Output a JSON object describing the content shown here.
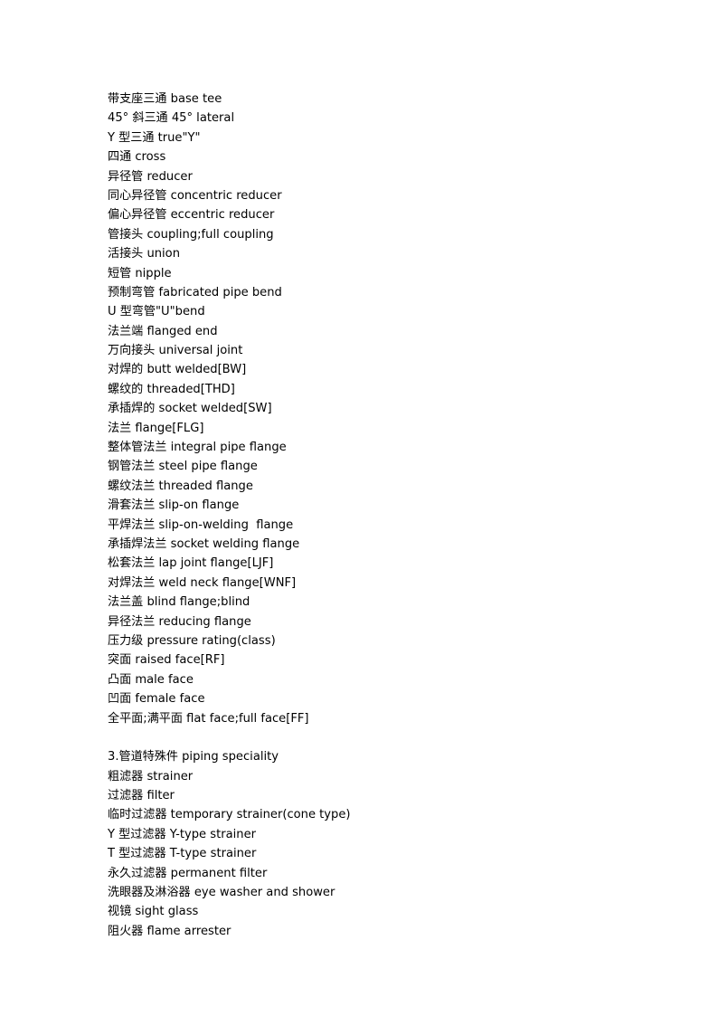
{
  "document": {
    "page_background": "#ffffff",
    "text_color": "#000000",
    "entries": [
      {
        "text": "带支座三通 base tee",
        "kind": "entry"
      },
      {
        "text": "45° 斜三通 45° lateral",
        "kind": "entry"
      },
      {
        "text": "Y 型三通 true\"Y\"",
        "kind": "entry"
      },
      {
        "text": "四通 cross",
        "kind": "entry"
      },
      {
        "text": "异径管 reducer",
        "kind": "entry"
      },
      {
        "text": "同心异径管 concentric reducer",
        "kind": "entry"
      },
      {
        "text": "偏心异径管 eccentric reducer",
        "kind": "entry"
      },
      {
        "text": "管接头 coupling;full coupling",
        "kind": "entry"
      },
      {
        "text": "活接头 union",
        "kind": "entry"
      },
      {
        "text": "短管 nipple",
        "kind": "entry"
      },
      {
        "text": "预制弯管 fabricated pipe bend",
        "kind": "entry"
      },
      {
        "text": "U 型弯管\"U\"bend",
        "kind": "entry"
      },
      {
        "text": "法兰端 flanged end",
        "kind": "entry"
      },
      {
        "text": "万向接头 universal joint",
        "kind": "entry"
      },
      {
        "text": "对焊的 butt welded[BW]",
        "kind": "entry"
      },
      {
        "text": "螺纹的 threaded[THD]",
        "kind": "entry"
      },
      {
        "text": "承插焊的 socket welded[SW]",
        "kind": "entry"
      },
      {
        "text": "法兰 flange[FLG]",
        "kind": "entry"
      },
      {
        "text": "整体管法兰 integral pipe flange",
        "kind": "entry"
      },
      {
        "text": "钢管法兰 steel pipe flange",
        "kind": "entry"
      },
      {
        "text": "螺纹法兰 threaded flange",
        "kind": "entry"
      },
      {
        "text": "滑套法兰 slip-on flange",
        "kind": "entry"
      },
      {
        "text": "平焊法兰 slip-on-welding  flange",
        "kind": "entry"
      },
      {
        "text": "承插焊法兰 socket welding flange",
        "kind": "entry"
      },
      {
        "text": "松套法兰 lap joint flange[LJF]",
        "kind": "entry"
      },
      {
        "text": "对焊法兰 weld neck flange[WNF]",
        "kind": "entry"
      },
      {
        "text": "法兰盖 blind flange;blind",
        "kind": "entry"
      },
      {
        "text": "异径法兰 reducing flange",
        "kind": "entry"
      },
      {
        "text": "压力级 pressure rating(class)",
        "kind": "entry"
      },
      {
        "text": "突面 raised face[RF]",
        "kind": "entry"
      },
      {
        "text": "凸面 male face",
        "kind": "entry"
      },
      {
        "text": "凹面 female face",
        "kind": "entry"
      },
      {
        "text": "全平面;满平面 flat face;full face[FF]",
        "kind": "entry"
      },
      {
        "text": "",
        "kind": "spacer"
      },
      {
        "text": "3.管道特殊件 piping speciality",
        "kind": "section-heading"
      },
      {
        "text": "粗滤器 strainer",
        "kind": "entry"
      },
      {
        "text": "过滤器 filter",
        "kind": "entry"
      },
      {
        "text": "临时过滤器 temporary strainer(cone type)",
        "kind": "entry"
      },
      {
        "text": "Y 型过滤器 Y-type strainer",
        "kind": "entry"
      },
      {
        "text": "T 型过滤器 T-type strainer",
        "kind": "entry"
      },
      {
        "text": "永久过滤器 permanent filter",
        "kind": "entry"
      },
      {
        "text": "洗眼器及淋浴器 eye washer and shower",
        "kind": "entry"
      },
      {
        "text": "视镜 sight glass",
        "kind": "entry"
      },
      {
        "text": "阻火器 flame arrester",
        "kind": "entry"
      }
    ]
  }
}
